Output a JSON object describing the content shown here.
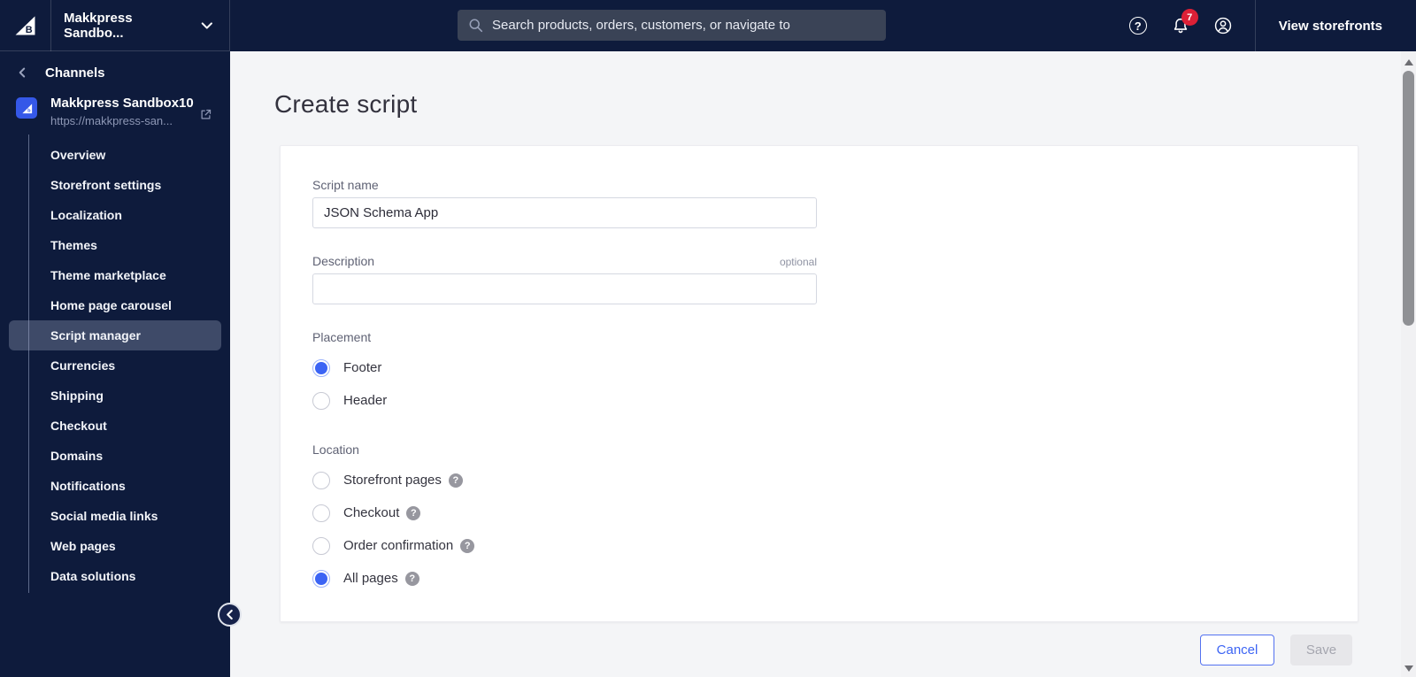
{
  "topnav": {
    "store_switcher": "Makkpress Sandbo...",
    "search": {
      "placeholder": "Search products, orders, customers, or navigate to"
    },
    "notifications_badge": "7",
    "view_storefronts": "View storefronts"
  },
  "sidebar": {
    "section_back": "Channels",
    "store": {
      "name": "Makkpress Sandbox10",
      "url": "https://makkpress-san..."
    },
    "items": [
      {
        "label": "Overview",
        "active": false
      },
      {
        "label": "Storefront settings",
        "active": false
      },
      {
        "label": "Localization",
        "active": false
      },
      {
        "label": "Themes",
        "active": false
      },
      {
        "label": "Theme marketplace",
        "active": false
      },
      {
        "label": "Home page carousel",
        "active": false
      },
      {
        "label": "Script manager",
        "active": true
      },
      {
        "label": "Currencies",
        "active": false
      },
      {
        "label": "Shipping",
        "active": false
      },
      {
        "label": "Checkout",
        "active": false
      },
      {
        "label": "Domains",
        "active": false
      },
      {
        "label": "Notifications",
        "active": false
      },
      {
        "label": "Social media links",
        "active": false
      },
      {
        "label": "Web pages",
        "active": false
      },
      {
        "label": "Data solutions",
        "active": false
      }
    ]
  },
  "page": {
    "title": "Create script",
    "form": {
      "script_name": {
        "label": "Script name",
        "value": "JSON Schema App"
      },
      "description": {
        "label": "Description",
        "badge": "optional",
        "value": ""
      },
      "placement": {
        "label": "Placement",
        "options": [
          {
            "label": "Footer",
            "selected": true,
            "help": false
          },
          {
            "label": "Header",
            "selected": false,
            "help": false
          }
        ]
      },
      "location": {
        "label": "Location",
        "options": [
          {
            "label": "Storefront pages",
            "selected": false,
            "help": true
          },
          {
            "label": "Checkout",
            "selected": false,
            "help": true
          },
          {
            "label": "Order confirmation",
            "selected": false,
            "help": true
          },
          {
            "label": "All pages",
            "selected": true,
            "help": true
          }
        ]
      }
    },
    "actions": {
      "cancel": "Cancel",
      "save": "Save"
    }
  },
  "icons": {
    "help_glyph": "?"
  },
  "colors": {
    "navy": "#0e1b3c",
    "accent_blue": "#3c64f4",
    "badge_red": "#dc2036",
    "active_item_bg": "#3e4a68",
    "content_bg": "#f4f5f7"
  }
}
